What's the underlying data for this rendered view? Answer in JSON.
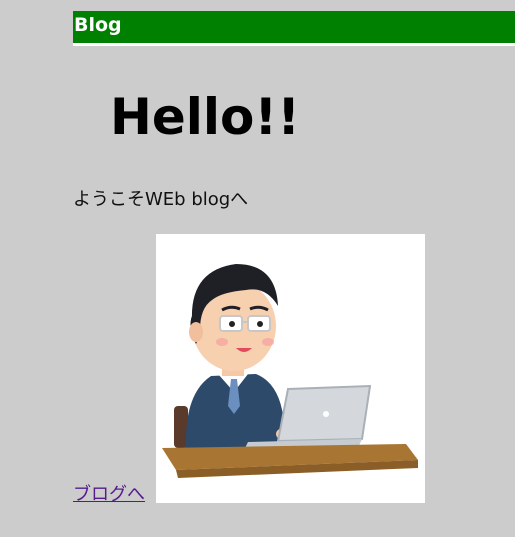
{
  "header": {
    "title": "Blog"
  },
  "main": {
    "heading": "Hello!!",
    "welcome_text": "ようこそWEb blogへ",
    "link_label": "ブログへ"
  },
  "colors": {
    "header_bg": "#008000",
    "page_bg": "#cccccc",
    "link": "#551a8b"
  },
  "image": {
    "icon": "man-with-laptop-illustration"
  }
}
